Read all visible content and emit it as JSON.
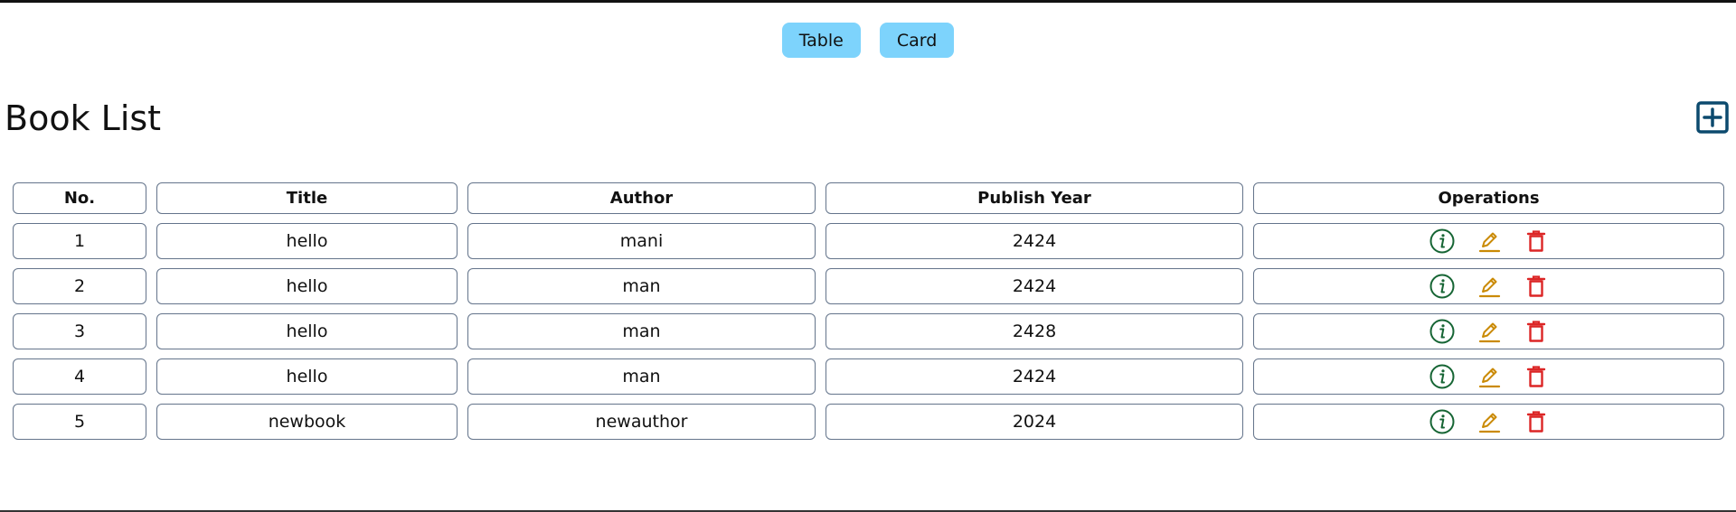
{
  "view_toggle": {
    "table_label": "Table",
    "card_label": "Card"
  },
  "page": {
    "title": "Book List",
    "add_icon": "plus-square-icon"
  },
  "table": {
    "headers": [
      "No.",
      "Title",
      "Author",
      "Publish Year",
      "Operations"
    ],
    "rows": [
      {
        "no": "1",
        "title": "hello",
        "author": "mani",
        "year": "2424"
      },
      {
        "no": "2",
        "title": "hello",
        "author": "man",
        "year": "2424"
      },
      {
        "no": "3",
        "title": "hello",
        "author": "man",
        "year": "2428"
      },
      {
        "no": "4",
        "title": "hello",
        "author": "man",
        "year": "2424"
      },
      {
        "no": "5",
        "title": "newbook",
        "author": "newauthor",
        "year": "2024"
      }
    ],
    "operation_icons": [
      "info-icon",
      "edit-icon",
      "delete-icon"
    ]
  },
  "colors": {
    "toggle_bg": "#7dd3fc",
    "add_icon": "#0c4a6e",
    "info_icon": "#166534",
    "edit_icon": "#ca8a04",
    "delete_icon": "#dc2626",
    "cell_border": "#64748b"
  }
}
